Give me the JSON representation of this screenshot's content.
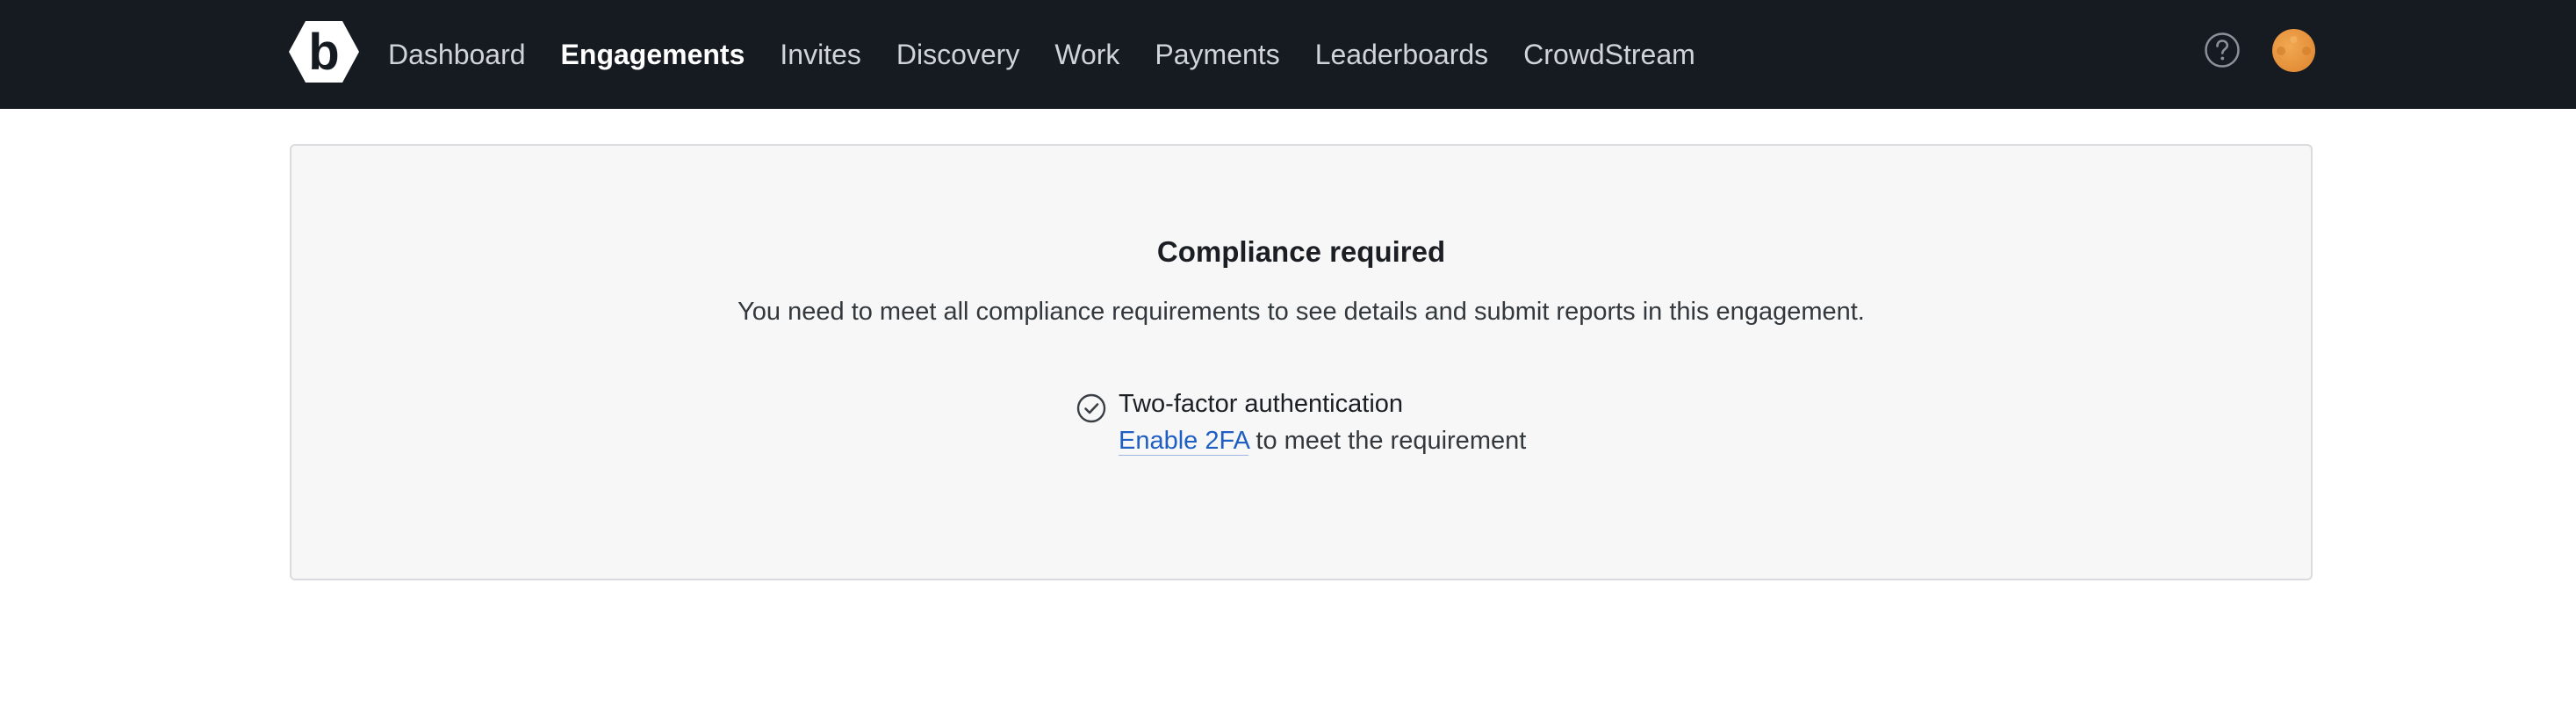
{
  "header": {
    "nav": [
      {
        "label": "Dashboard"
      },
      {
        "label": "Engagements"
      },
      {
        "label": "Invites"
      },
      {
        "label": "Discovery"
      },
      {
        "label": "Work"
      },
      {
        "label": "Payments"
      },
      {
        "label": "Leaderboards"
      },
      {
        "label": "CrowdStream"
      }
    ],
    "active": "Engagements",
    "icons": {
      "logo": "bugcrowd-hex-logo-icon",
      "help": "help-circle-icon",
      "avatar": "user-avatar"
    },
    "colors": {
      "background": "#161b22",
      "nav_text": "#d0d4d9",
      "active_text": "#ffffff",
      "avatar": "#e6923c"
    }
  },
  "compliance": {
    "title": "Compliance required",
    "message": "You need to meet all compliance requirements to see details and submit reports in this engagement.",
    "requirement": {
      "icon": "check-circle-icon",
      "title": "Two-factor authentication",
      "link_label": "Enable 2FA",
      "suffix": " to meet the requirement"
    },
    "colors": {
      "panel_bg": "#f7f7f7",
      "link": "#1f5fc4"
    }
  }
}
